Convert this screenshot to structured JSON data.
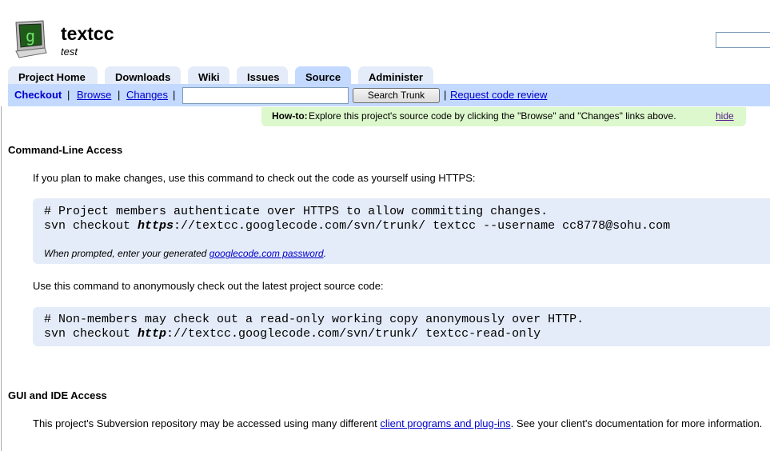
{
  "header": {
    "project_name": "textcc",
    "project_summary": "test"
  },
  "tabs": [
    {
      "label": "Project Home"
    },
    {
      "label": "Downloads"
    },
    {
      "label": "Wiki"
    },
    {
      "label": "Issues"
    },
    {
      "label": "Source",
      "active": true
    },
    {
      "label": "Administer"
    }
  ],
  "subnav": {
    "checkout": "Checkout",
    "browse": "Browse",
    "changes": "Changes",
    "sep": "|",
    "search_value": "",
    "search_button": "Search Trunk",
    "request_review": "Request code review"
  },
  "howto": {
    "label": "How-to:",
    "text": "Explore this project's source code by clicking the \"Browse\" and \"Changes\" links above.",
    "hide": "hide"
  },
  "cli": {
    "heading": "Command-Line Access",
    "intro_members": "If you plan to make changes, use this command to check out the code as yourself using HTTPS:",
    "members_comment": "# Project members authenticate over HTTPS to allow committing changes.",
    "members_cmd_prefix": "svn checkout ",
    "members_scheme": "https",
    "members_cmd_rest": "://textcc.googlecode.com/svn/trunk/ textcc --username cc8778@sohu.com",
    "prompt_text": "When prompted, enter your generated ",
    "prompt_link": "googlecode.com password",
    "prompt_end": ".",
    "intro_anon": "Use this command to anonymously check out the latest project source code:",
    "anon_comment": "# Non-members may check out a read-only working copy anonymously over HTTP.",
    "anon_cmd_prefix": "svn checkout ",
    "anon_scheme": "http",
    "anon_cmd_rest": "://textcc.googlecode.com/svn/trunk/ textcc-read-only"
  },
  "gui": {
    "heading": "GUI and IDE Access",
    "text_before": "This project's Subversion repository may be accessed using many different ",
    "link": "client programs and plug-ins",
    "text_after": ". See your client's documentation for more information."
  },
  "colors": {
    "tab_bg": "#e5ecf9",
    "tab_active_bg": "#c3d9ff",
    "howto_bg": "#ddf8cc",
    "code_bg": "#e5ecf9",
    "link": "#0000cc"
  },
  "icons": {
    "logo": "monitor-logo-icon"
  }
}
